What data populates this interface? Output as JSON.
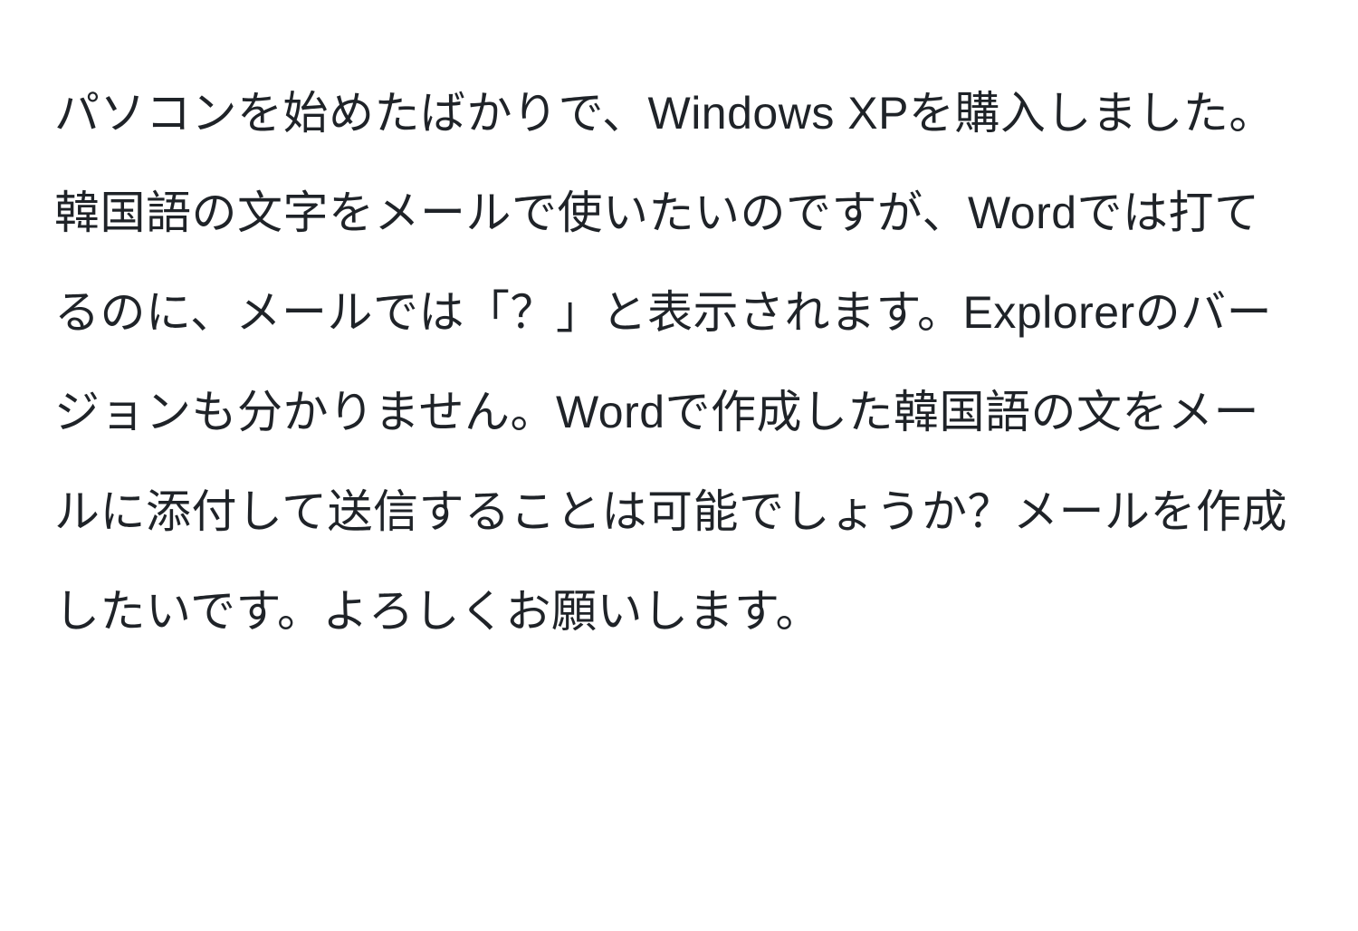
{
  "paragraph": {
    "text": "パソコンを始めたばかりで、Windows XPを購入しました。韓国語の文字をメールで使いたいのですが、Wordでは打てるのに、メールでは「？」と表示されます。Explorerのバージョンも分かりません。Wordで作成した韓国語の文をメールに添付して送信することは可能でしょうか？メールを作成したいです。よろしくお願いします。"
  }
}
